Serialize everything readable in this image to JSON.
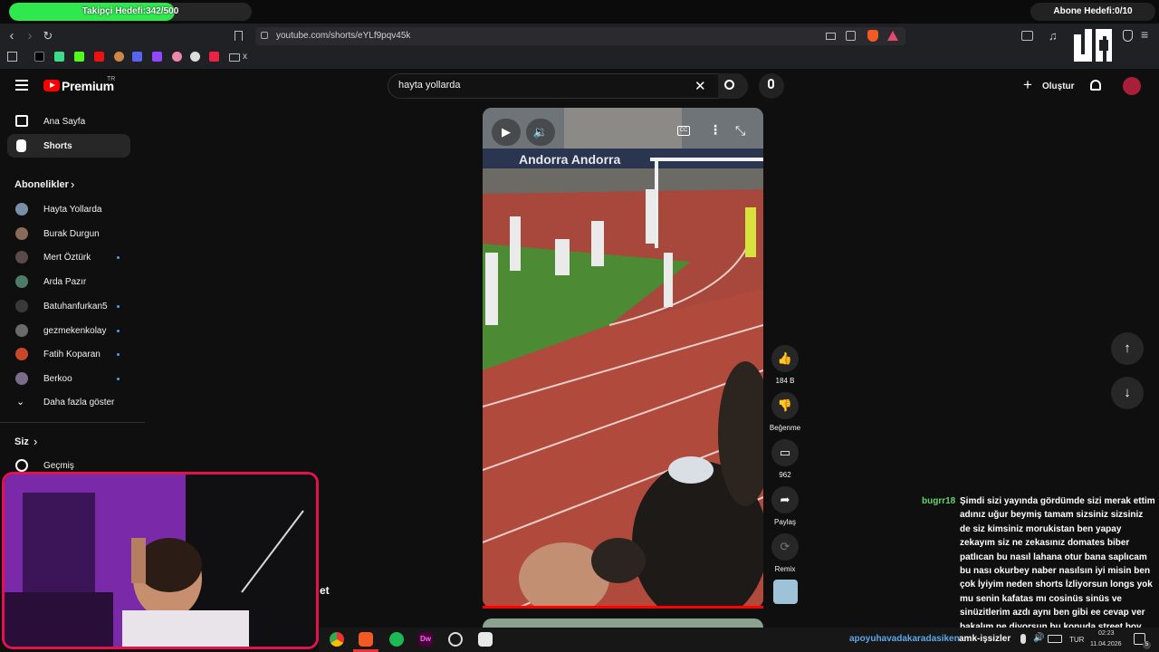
{
  "stream_overlay": {
    "follow_goal": "Takipçi Hedefi:342/500",
    "follow_progress": 0.684,
    "sub_goal": "Abone Hedefi:0/10",
    "cam_caption": "et"
  },
  "browser": {
    "url": "youtube.com/shorts/eYLf9pqv45k",
    "bookmark_folder_label": "x"
  },
  "youtube": {
    "logo_text": "Premium",
    "logo_region": "TR",
    "search_value": "hayta yollarda",
    "create_label": "Oluştur",
    "sidebar": {
      "home": "Ana Sayfa",
      "shorts": "Shorts",
      "subscriptions_title": "Abonelikler",
      "subscriptions": [
        {
          "name": "Hayta Yollarda",
          "new": false,
          "color": "#7a8ea8"
        },
        {
          "name": "Burak Durgun",
          "new": false,
          "color": "#8a6a58"
        },
        {
          "name": "Mert Öztürk",
          "new": true,
          "color": "#5a4a4a"
        },
        {
          "name": "Arda Pazır",
          "new": false,
          "color": "#4d7b6a"
        },
        {
          "name": "Batuhanfurkan5",
          "new": true,
          "color": "#3a3a3a"
        },
        {
          "name": "gezmekenkolay",
          "new": true,
          "color": "#6a6a6a"
        },
        {
          "name": "Fatih Koparan",
          "new": true,
          "color": "#c9472a"
        },
        {
          "name": "Berkoo",
          "new": true,
          "color": "#7c6c8c"
        }
      ],
      "show_more": "Daha fazla göster",
      "you_title": "Siz",
      "history": "Geçmiş"
    },
    "actions": {
      "likes": "184 B",
      "dislike": "Beğenme",
      "comments": "962",
      "share": "Paylaş",
      "remix": "Remix"
    }
  },
  "chat": {
    "username": "bugrr18",
    "message": "Şimdi sizi yayında gördümde sizi merak ettim adınız uğur beymiş tamam sizsiniz sizsiniz de siz kimsiniz morukistan ben yapay zekayım siz ne zekasınız domates biber patlıcan bu nasıl lahana otur bana saplıcam bu nası okurbey naber nasılsın iyi misin ben çok İyiyim neden shorts İzliyorsun longs yok mu senin kafatas mı cosinüs sinüs ve sinüzitlerim azdı aynı ben gibi ee cevap ver bakalım ne diyorsun bu konuda street boy",
    "ticker_user": "apoyuhavadakaradasiken",
    "ticker_text": "amk-işsizler"
  },
  "taskbar": {
    "lang": "TUR",
    "time": "02:23",
    "date": "11.04.2026",
    "notif_count": "5"
  }
}
